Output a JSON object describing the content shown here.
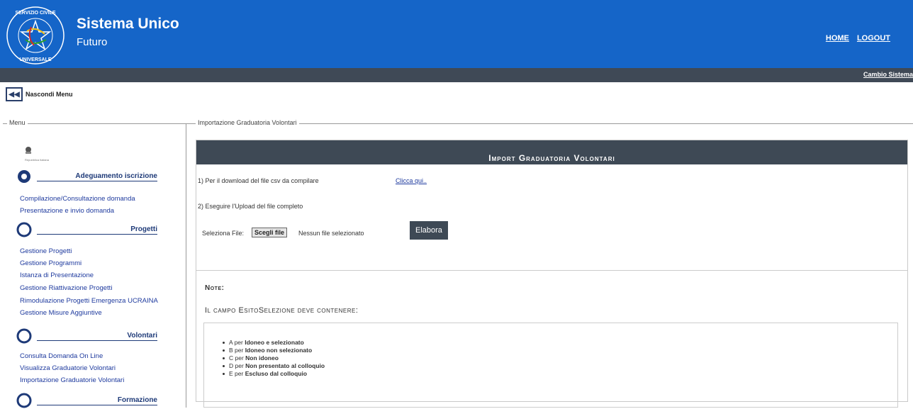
{
  "header": {
    "logo_icon": "servizio-civile-universale-logo",
    "logo_text": "SERVIZIO CIVILE UNIVERSALE",
    "title": "Sistema Unico",
    "subtitle": "Futuro",
    "links": {
      "home": "HOME",
      "logout": "LOGOUT"
    },
    "bg_color": "#1565c8"
  },
  "subbar": {
    "link": "Cambio Sistema",
    "bg_color": "#3f4956"
  },
  "hide_menu": {
    "label": "Nascondi Menu",
    "icon": "double-left-arrow-icon"
  },
  "menu": {
    "legend": "Menu",
    "emblem_text": "Repubblica Italiana",
    "sections": [
      {
        "title": "Adeguamento iscrizione",
        "icon": "gear-icon",
        "items": [
          "Compilazione/Consultazione domanda",
          "Presentazione e invio domanda"
        ]
      },
      {
        "title": "Progetti",
        "icon": "gear-icon",
        "items": [
          "Gestione Progetti",
          "Gestione Programmi",
          "Istanza di Presentazione",
          "Gestione Riattivazione Progetti",
          "Rimodulazione Progetti Emergenza UCRAINA",
          "Gestione Misure Aggiuntive"
        ]
      },
      {
        "title": "Volontari",
        "icon": "gear-icon",
        "items": [
          "Consulta Domanda On Line",
          "Visualizza Graduatorie Volontari",
          "Importazione Graduatorie Volontari"
        ]
      },
      {
        "title": "Formazione",
        "icon": "gear-icon",
        "items": []
      }
    ]
  },
  "main": {
    "legend": "Importazione Graduatoria Volontari",
    "panel_title": "Import Graduatoria Volontari",
    "step1_text": "1) Per il download del file csv da compilare",
    "step1_link": "Clicca qui..",
    "step2_text": "2) Eseguire l'Upload del file completo",
    "file_label": "Seleziona File:",
    "choose_button": "Scegli file",
    "no_file_text": "Nessun file selezionato",
    "submit_button": "Elabora",
    "note_title": "Note:",
    "esito_text": "Il campo EsitoSelezione deve contenere:",
    "esito_items": [
      {
        "code": "A",
        "mid": " per ",
        "desc": "Idoneo e selezionato"
      },
      {
        "code": "B",
        "mid": " per ",
        "desc": "Idoneo non selezionato"
      },
      {
        "code": "C",
        "mid": " per ",
        "desc": "Non idoneo"
      },
      {
        "code": "D",
        "mid": " per ",
        "desc": "Non presentato al colloquio"
      },
      {
        "code": "E",
        "mid": " per ",
        "desc": "Escluso dal colloquio"
      }
    ]
  }
}
